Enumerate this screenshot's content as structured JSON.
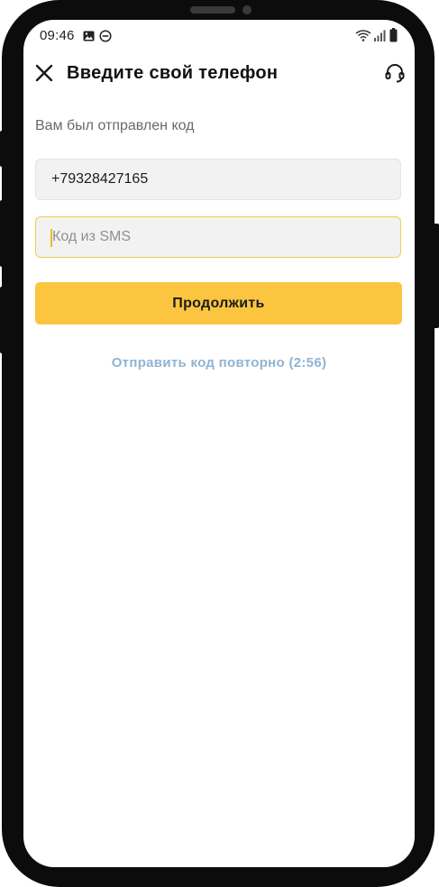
{
  "status_bar": {
    "time": "09:46",
    "icons": [
      "image-icon",
      "do-not-disturb-icon",
      "wifi-icon",
      "signal-icon",
      "battery-icon"
    ]
  },
  "header": {
    "title": "Введите свой телефон",
    "close_icon": "close-icon",
    "support_icon": "headset-icon"
  },
  "form": {
    "subtitle": "Вам был отправлен код",
    "phone_value": "+79328427165",
    "code_placeholder": "Код из SMS",
    "continue_label": "Продолжить",
    "resend_label": "Отправить код повторно (2:56)"
  },
  "colors": {
    "accent": "#fcc540",
    "link": "#8fb4d3",
    "focus_border": "#f2cd4f"
  }
}
